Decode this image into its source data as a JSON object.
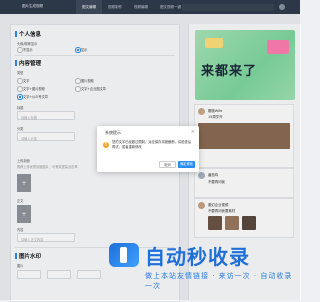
{
  "topbar": {
    "brand": "图片生成视频",
    "tabs": [
      "图文编辑",
      "视频制作",
      "视频编辑",
      "图文视频一键"
    ]
  },
  "form": {
    "section_personal": "个人信息",
    "section_content": "内容管理",
    "section_images": "图片水印",
    "fields": [
      "头像/昵称显示",
      "类型",
      "文字",
      "标题",
      "分类",
      "上传封面",
      "正文",
      "内容",
      "图片"
    ],
    "options": {
      "personal_a": "不显示",
      "personal_b": "显示",
      "type_a": "文字",
      "type_b": "图片视频",
      "type_c": "文字+图片视频",
      "type_d": "文字+企业图文章",
      "type_e": "文字+公众号文章"
    },
    "placeholders": {
      "title": "请输入标题",
      "category": "请输入分类",
      "upload_hint": "推荐上传优质封面图片，可有效提高点击率",
      "content": "请输入正文内容"
    }
  },
  "dialog": {
    "title": "系统提示",
    "close": "×",
    "message": "您的文字已经超过限制，对应保存将被截断，请检查后再试，或者重新修改",
    "cancel": "取消",
    "ok": "确定修改"
  },
  "preview": {
    "banner_text": "来都来了",
    "feeds": [
      {
        "name": "樱桃Wife",
        "text": "15周岁开"
      },
      {
        "name": "番茄鸡",
        "text": "不要再问我"
      },
      {
        "name": "魔幻企业视频",
        "text": "不要再问我要素材"
      }
    ]
  },
  "watermark": {
    "title": "自动秒收录",
    "subtitle": "做上本站友情链接 · 来访一次 · 自动收录一次"
  },
  "colors": {
    "accent": "#2a8bf2",
    "topbar": "#2f3b4c",
    "warning": "#f5a623"
  }
}
